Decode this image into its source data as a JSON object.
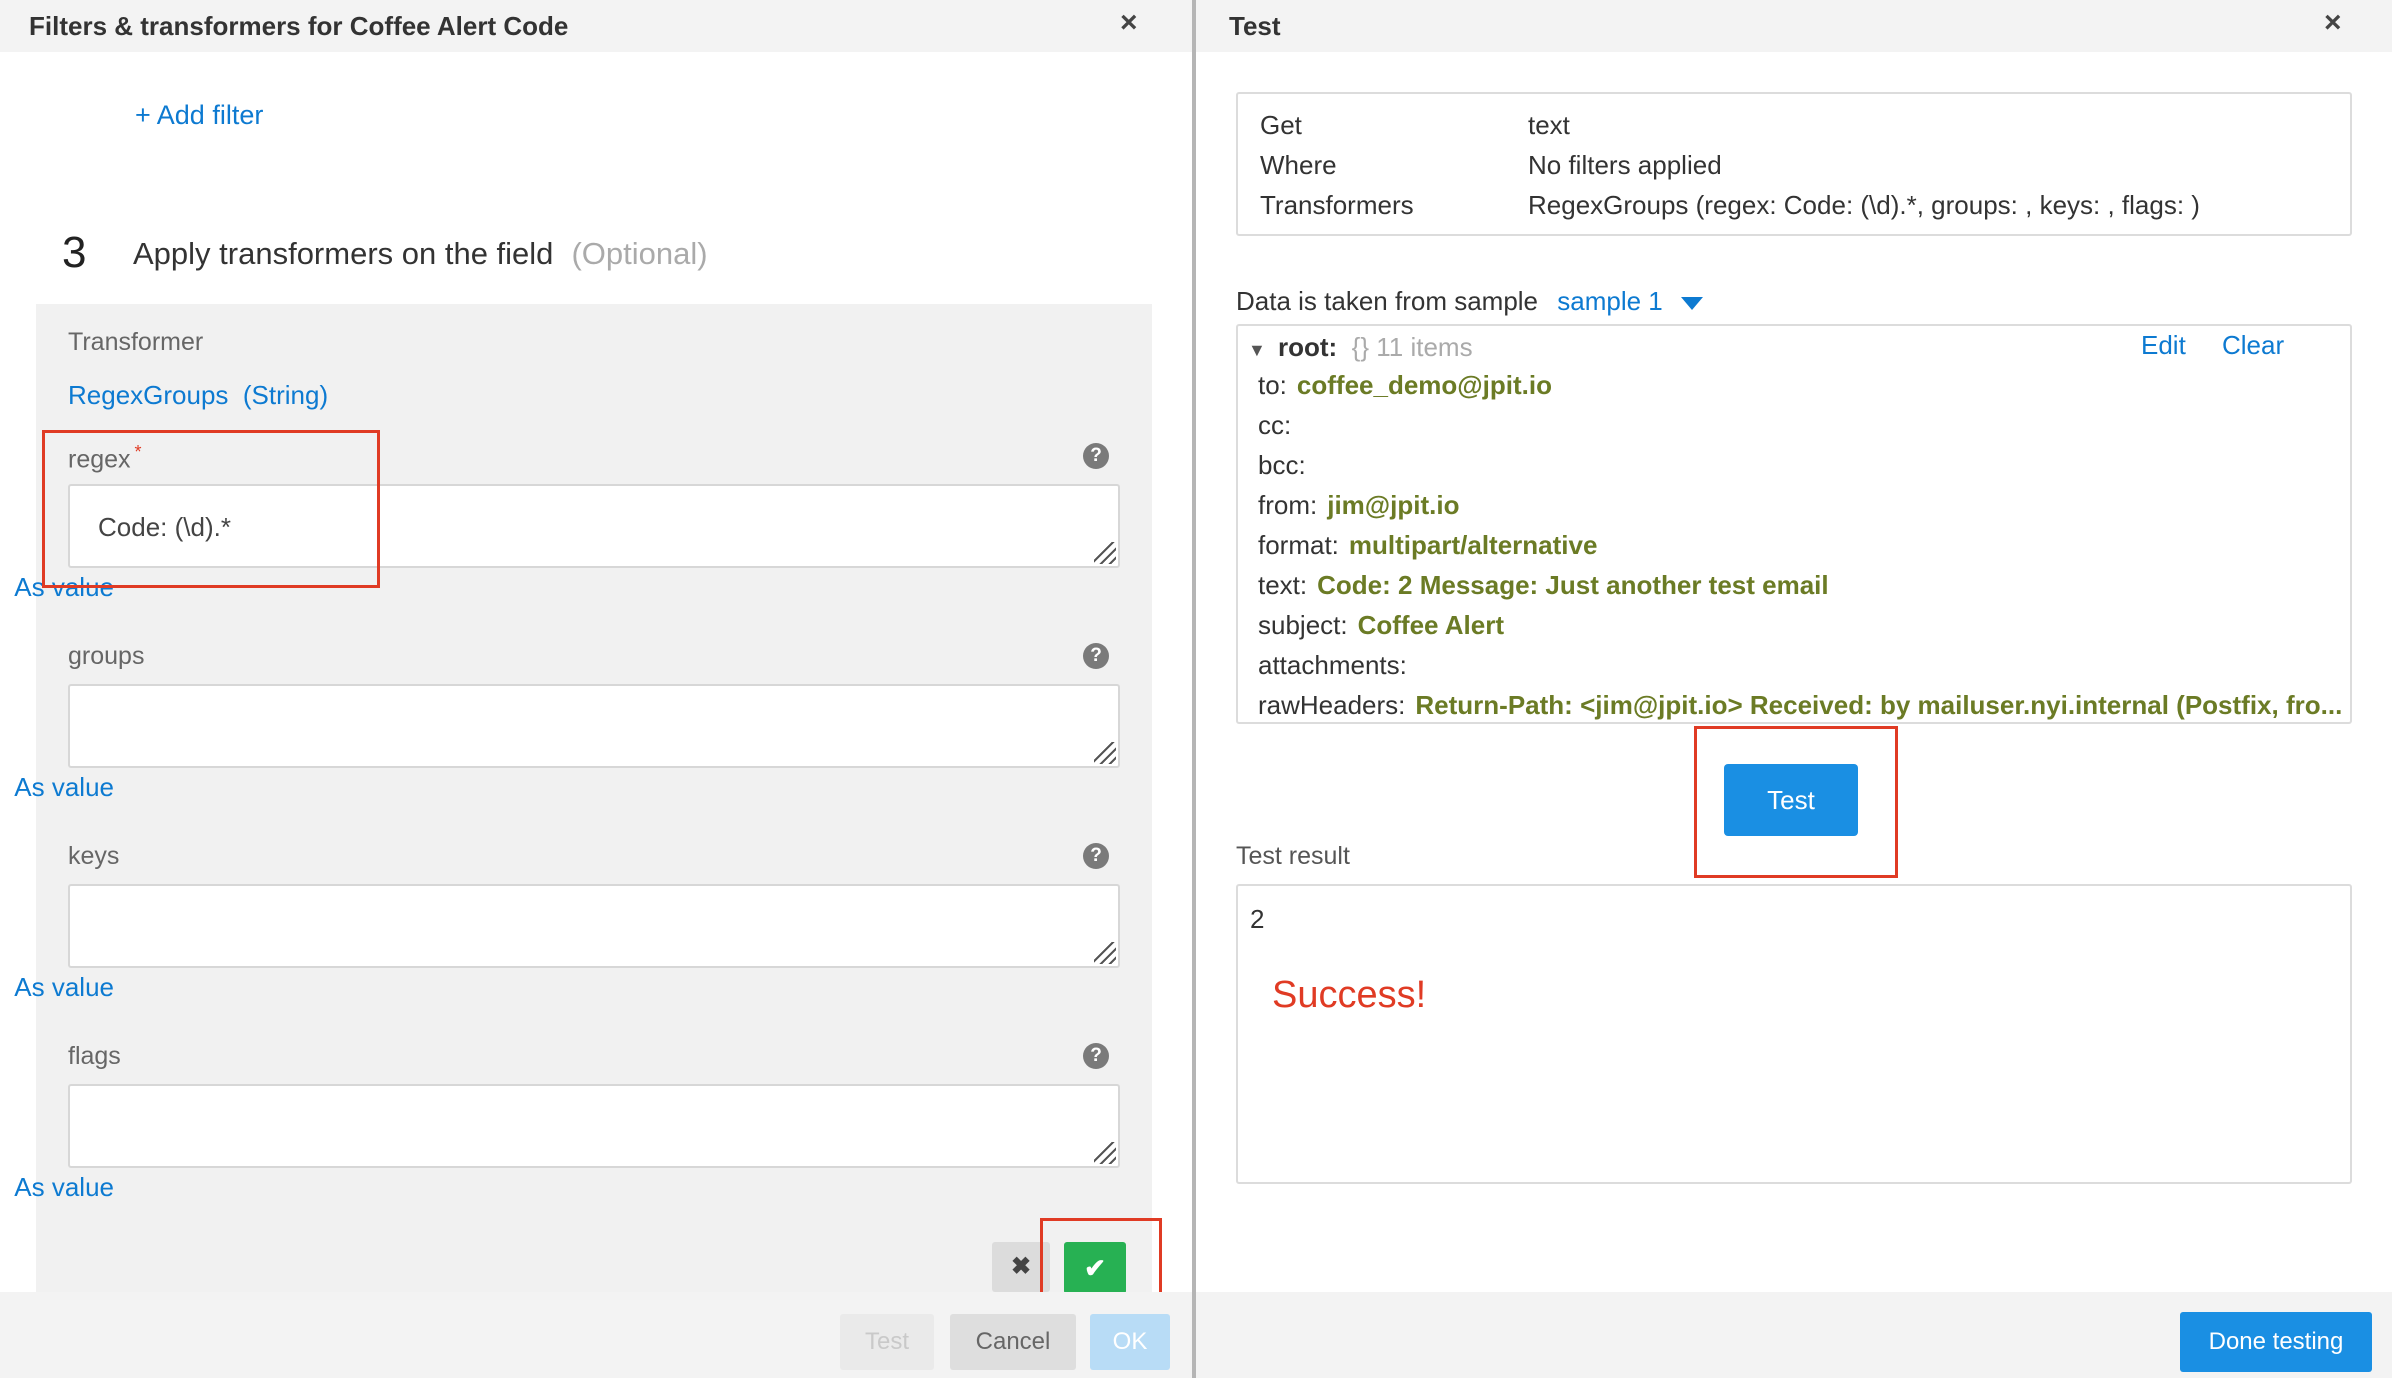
{
  "left_panel": {
    "title": "Filters & transformers for Coffee Alert Code",
    "close_glyph": "×",
    "add_filter": "+ Add filter",
    "step_number": "3",
    "step_title": "Apply transformers on the field",
    "step_optional": "(Optional)",
    "transformer_label": "Transformer",
    "transformer_name": "RegexGroups",
    "transformer_type": "(String)",
    "fields": [
      {
        "label": "regex",
        "required_mark": "*",
        "value": "Code: (\\d).*",
        "as_value": "As value"
      },
      {
        "label": "groups",
        "value": "",
        "as_value": "As value"
      },
      {
        "label": "keys",
        "value": "",
        "as_value": "As value"
      },
      {
        "label": "flags",
        "value": "",
        "as_value": "As value"
      }
    ],
    "help_glyph": "?",
    "cancel_glyph": "✖",
    "confirm_glyph": "✔",
    "footer": {
      "test": "Test",
      "cancel": "Cancel",
      "ok": "OK"
    }
  },
  "right_panel": {
    "title": "Test",
    "close_glyph": "×",
    "summary": [
      {
        "key": "Get",
        "value": "text"
      },
      {
        "key": "Where",
        "value": "No filters applied"
      },
      {
        "key": "Transformers",
        "value": "RegexGroups (regex: Code: (\\d).*, groups: , keys: , flags: )"
      }
    ],
    "sample_label": "Data is taken from sample",
    "sample_value": "sample 1",
    "root_label": "root:",
    "root_meta": "{} 11 items",
    "edit": "Edit",
    "clear": "Clear",
    "data_rows": [
      {
        "key": "to:",
        "value": "coffee_demo@jpit.io"
      },
      {
        "key": "cc:",
        "value": ""
      },
      {
        "key": "bcc:",
        "value": ""
      },
      {
        "key": "from:",
        "value": "jim@jpit.io"
      },
      {
        "key": "format:",
        "value": "multipart/alternative"
      },
      {
        "key": "text:",
        "value": "Code: 2 Message: Just another test email"
      },
      {
        "key": "subject:",
        "value": "Coffee Alert"
      },
      {
        "key": "attachments:",
        "value": ""
      },
      {
        "key": "rawHeaders:",
        "value": "Return-Path: <jim@jpit.io> Received: by mailuser.nyi.internal (Postfix, fro..."
      }
    ],
    "test_button": "Test",
    "result_label": "Test result",
    "result_value": "2",
    "success_note": "Success!",
    "done_button": "Done testing"
  },
  "colors": {
    "link": "#0d7ad1",
    "annotation_red": "#e03b24",
    "confirm_green": "#27b153",
    "primary_blue": "#1a8fe3",
    "data_value_olive": "#6b7b25"
  }
}
